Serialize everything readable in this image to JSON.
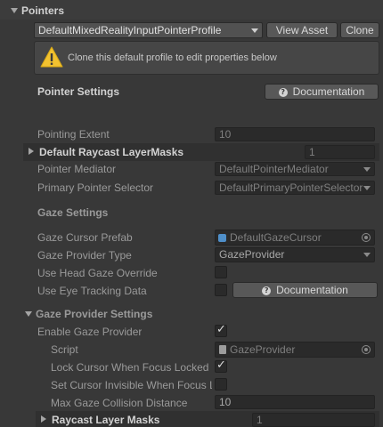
{
  "header": {
    "title": "Pointers"
  },
  "profile": {
    "selected": "DefaultMixedRealityInputPointerProfile",
    "view_asset_label": "View Asset",
    "clone_label": "Clone"
  },
  "warning": {
    "text": "Clone this default profile to edit properties below",
    "icon": "warning-icon"
  },
  "pointer_settings": {
    "title": "Pointer Settings",
    "documentation_label": "Documentation",
    "pointing_extent_label": "Pointing Extent",
    "pointing_extent_value": "10",
    "raycast_masks_label": "Default Raycast LayerMasks",
    "raycast_masks_value": "1",
    "pointer_mediator_label": "Pointer Mediator",
    "pointer_mediator_value": "DefaultPointerMediator",
    "primary_selector_label": "Primary Pointer Selector",
    "primary_selector_value": "DefaultPrimaryPointerSelector"
  },
  "gaze_settings": {
    "title": "Gaze Settings",
    "cursor_prefab_label": "Gaze Cursor Prefab",
    "cursor_prefab_value": "DefaultGazeCursor",
    "provider_type_label": "Gaze Provider Type",
    "provider_type_value": "GazeProvider",
    "head_gaze_override_label": "Use Head Gaze Override",
    "head_gaze_override_checked": false,
    "eye_tracking_label": "Use Eye Tracking Data",
    "eye_tracking_checked": false,
    "documentation_label": "Documentation"
  },
  "gaze_provider_settings": {
    "title": "Gaze Provider Settings",
    "enable_label": "Enable Gaze Provider",
    "enable_checked": true,
    "script_label": "Script",
    "script_value": "GazeProvider",
    "lock_cursor_label": "Lock Cursor When Focus Locked",
    "lock_cursor_checked": true,
    "cursor_invisible_label": "Set Cursor Invisible When Focus Locked",
    "cursor_invisible_checked": false,
    "max_distance_label": "Max Gaze Collision Distance",
    "max_distance_value": "10",
    "raycast_masks_label": "Raycast Layer Masks",
    "raycast_masks_value": "1"
  }
}
